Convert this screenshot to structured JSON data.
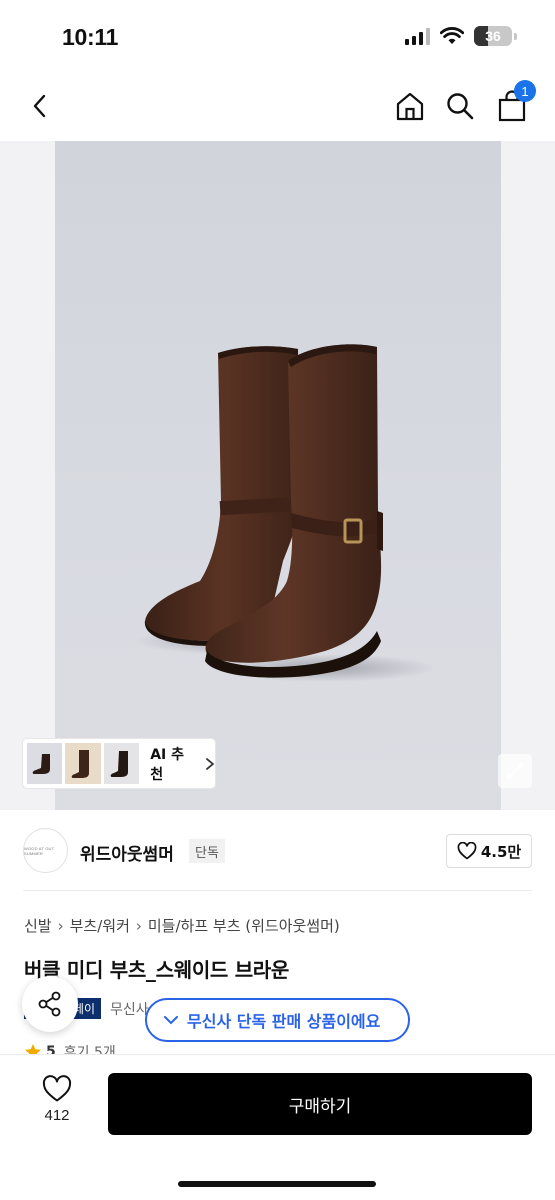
{
  "status_bar": {
    "time": "10:11",
    "battery": "36",
    "battery_level": 0.36
  },
  "nav": {
    "cart_badge": "1"
  },
  "gallery": {
    "ai_label": "AI 추천"
  },
  "brand": {
    "logo_text": "WOOD AT OUT SUMMER",
    "name": "위드아웃썸머",
    "tag": "단독",
    "likes": "4.5만"
  },
  "breadcrumb": {
    "items": [
      "신발",
      "부츠/워커",
      "미들/하프 부츠 (위드아웃썸머)"
    ]
  },
  "product": {
    "title": "버클 미디 부츠_스웨이드 브라운",
    "pay_badge": "페이",
    "pay_text": "무신사",
    "rating": "5",
    "reviews": "후기 5개"
  },
  "toast": {
    "text": "무신사 단독 판매 상품이에요"
  },
  "bottom": {
    "wish_count": "412",
    "buy_label": "구매하기"
  },
  "colors": {
    "accent": "#2a63e8",
    "badge": "#1a73e8",
    "pay": "#0d2f6e",
    "boot": "#4a2a1d"
  }
}
